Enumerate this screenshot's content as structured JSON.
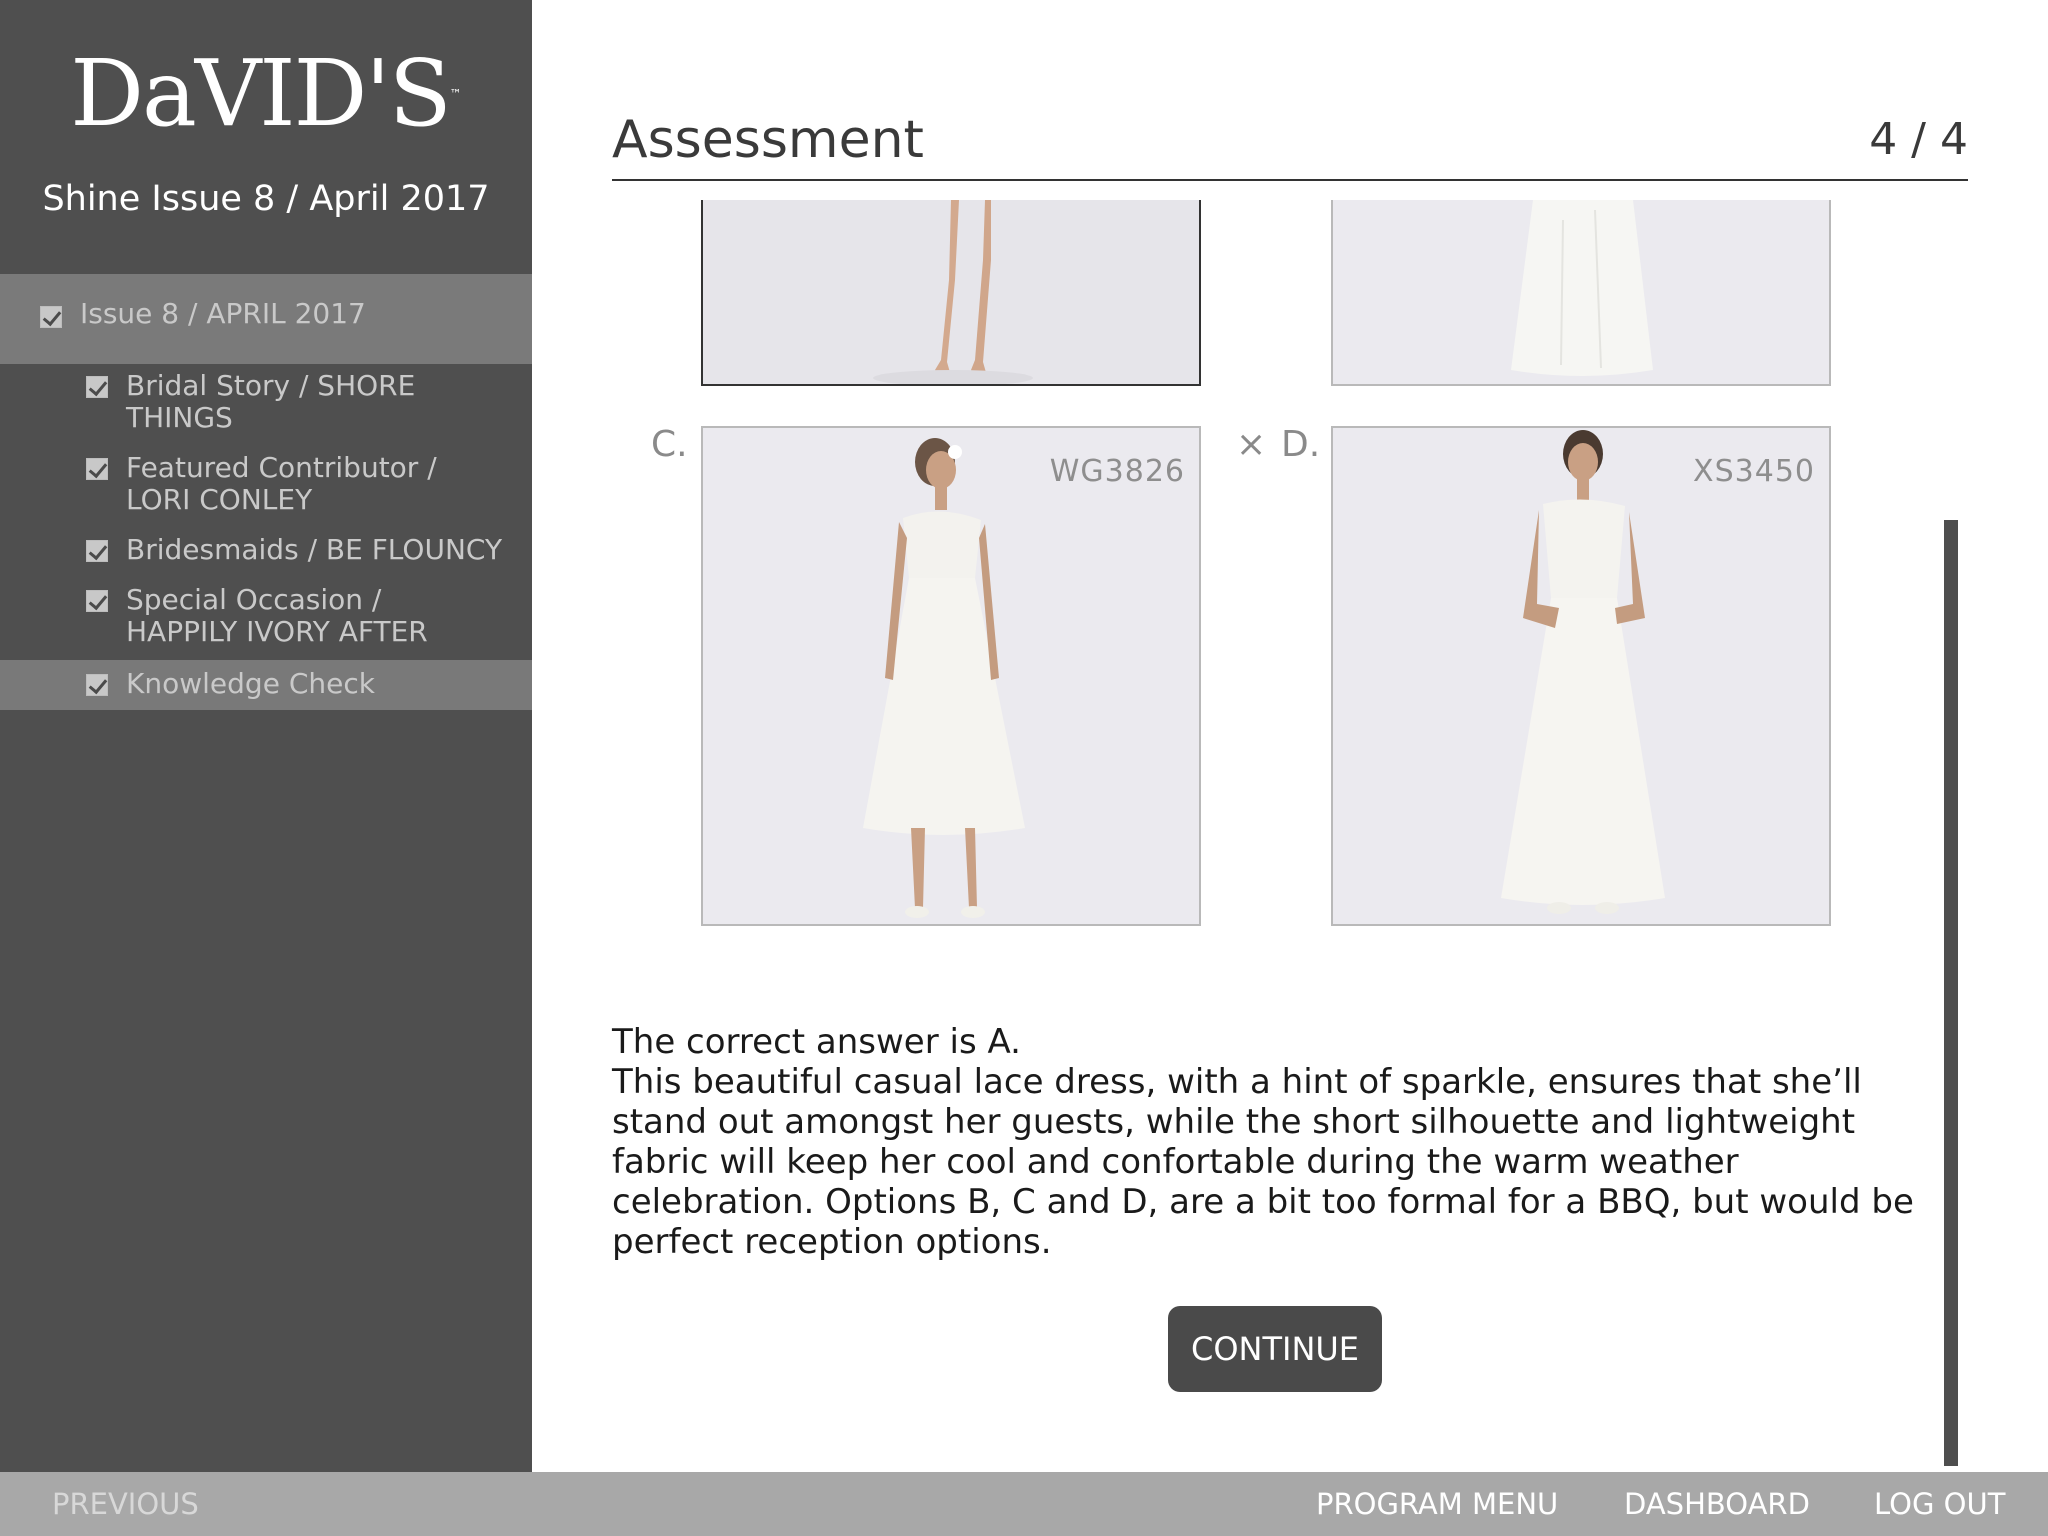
{
  "sidebar": {
    "logo_text": "DaVID'S",
    "logo_tm": "™",
    "course_title": "Shine Issue 8 / April 2017",
    "items": [
      {
        "line1": "Issue 8 / APRIL 2017",
        "line2": ""
      },
      {
        "line1": "Bridal Story / SHORE",
        "line2": "THINGS"
      },
      {
        "line1": "Featured Contributor /",
        "line2": "LORI CONLEY"
      },
      {
        "line1": "Bridesmaids / BE FLOUNCY",
        "line2": ""
      },
      {
        "line1": "Special Occasion /",
        "line2": "HAPPILY IVORY AFTER"
      },
      {
        "line1": "Knowledge Check",
        "line2": ""
      }
    ]
  },
  "header": {
    "title": "Assessment",
    "page_indicator": "4 / 4"
  },
  "options": {
    "c": {
      "label": "C.",
      "code": "WG3826"
    },
    "d": {
      "label": "D.",
      "mark": "×",
      "code": "XS3450"
    }
  },
  "explanation": {
    "answer_line": "The correct answer is A.",
    "body": "This beautiful casual lace dress, with a hint of sparkle, ensures that she’ll stand out amongst her guests, while the short silhouette and lightweight fabric will keep her cool and confortable during the warm weather celebration. Options B, C and D, are a bit too formal for a BBQ, but would be perfect reception options."
  },
  "continue_label": "CONTINUE",
  "footer": {
    "previous": "PREVIOUS",
    "program_menu": "PROGRAM MENU",
    "dashboard": "DASHBOARD",
    "logout": "LOG OUT"
  },
  "colors": {
    "sidebar_bg": "#4f4f4f",
    "sidebar_active": "#7a7a7a",
    "footer_bg": "#a8a8a8",
    "button_bg": "#4a4a4a"
  },
  "icons": [
    "checkbox-checked-icon",
    "incorrect-x-icon",
    "brand-logo"
  ]
}
